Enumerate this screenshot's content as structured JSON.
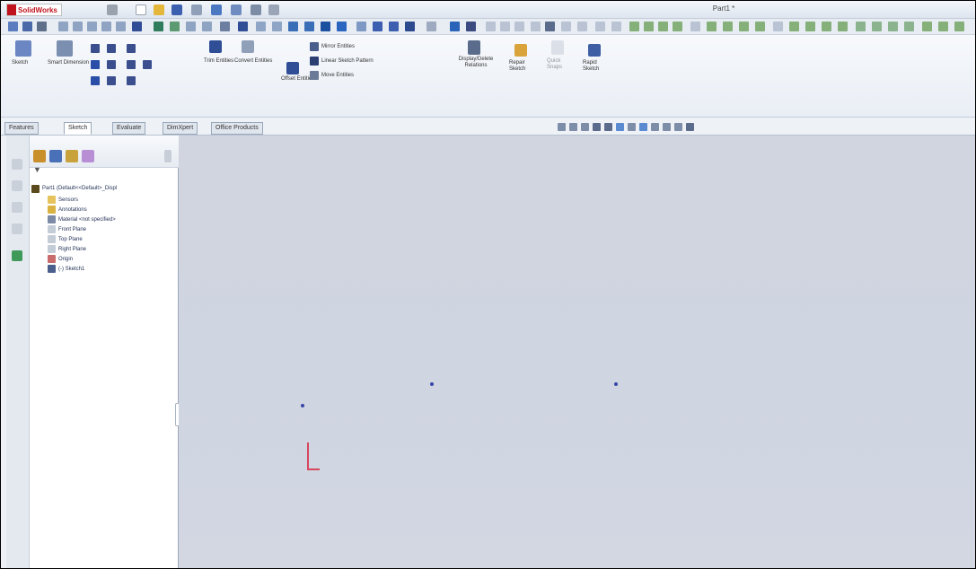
{
  "window": {
    "app_name": "SolidWorks",
    "title": "Part1 *"
  },
  "ribbon": {
    "sketch": "Sketch",
    "smart_dimension": "Smart Dimension",
    "trim_entities": "Trim Entities",
    "convert_entities": "Convert Entities",
    "offset_entities": "Offset Entities",
    "mirror_entities": "Mirror Entities",
    "linear_sketch_pattern": "Linear Sketch Pattern",
    "move_entities": "Move Entities",
    "display_delete_relations": "Display/Delete Relations",
    "repair_sketch": "Repair Sketch",
    "quick_snaps": "Quick Snaps",
    "rapid_sketch": "Rapid Sketch"
  },
  "tabs": [
    "Features",
    "Sketch",
    "Evaluate",
    "DimXpert",
    "Office Products"
  ],
  "active_tab": "Sketch",
  "feature_tree": {
    "root": "Part1 (Default<<Default>_Displ",
    "items": [
      "Sensors",
      "Annotations",
      "Material <not specified>",
      "Front Plane",
      "Top Plane",
      "Right Plane",
      "Origin",
      "(-) Sketch1"
    ]
  },
  "colors": {
    "accent": "#2b4fa8",
    "graphics_bg": "#d0d5e0",
    "origin_red": "#d7475e",
    "sketch_point": "#3a46a8"
  }
}
